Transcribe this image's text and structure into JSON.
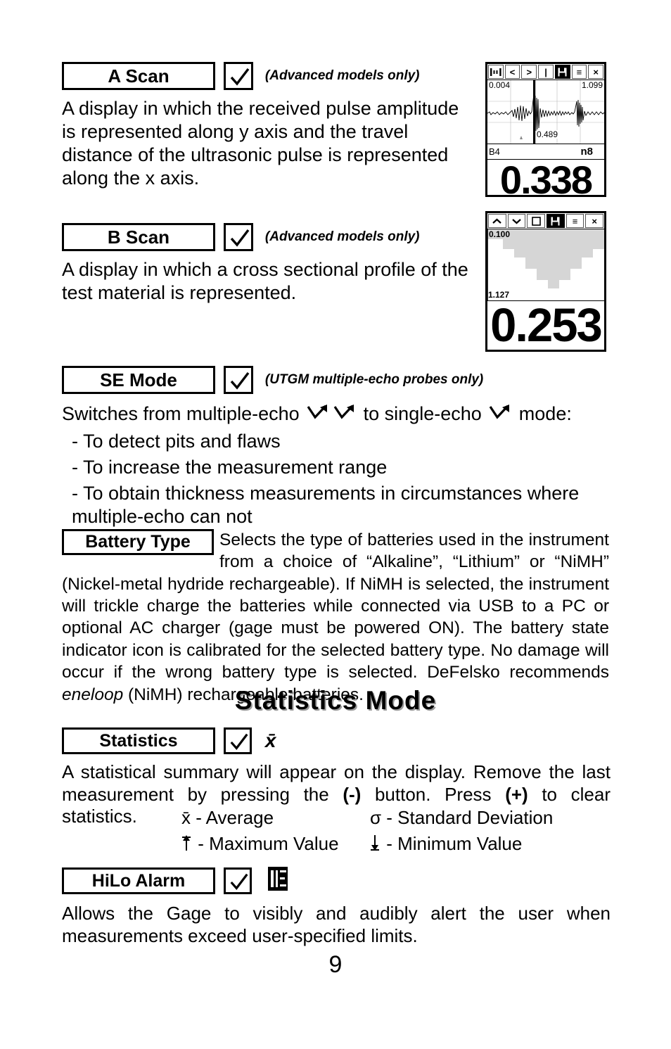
{
  "page": {
    "number": "9"
  },
  "sections": [
    {
      "id": "a-scan",
      "label": "A Scan",
      "note": "(Advanced models only)",
      "body": "A display in which the received pulse amplitude is represented along y axis and the travel distance of the ultrasonic pulse is represented along the x axis."
    },
    {
      "id": "b-scan",
      "label": "B Scan",
      "note": "(Advanced models only)",
      "body": "A display in which a cross sectional profile of the test material is represented."
    },
    {
      "id": "se-mode",
      "label": "SE Mode",
      "note": "(UTGM multiple-echo probes only)",
      "intro_before": "Switches from multiple-echo",
      "intro_middle": "to single-echo",
      "intro_after": "mode:",
      "bullets": [
        "- To detect pits and flaws",
        "- To increase the measurement range",
        "- To obtain thickness measurements in circumstances where multiple-echo can not"
      ]
    }
  ],
  "battery": {
    "label": "Battery Type",
    "body_part1": "Selects the type of batteries used in the instrument from a choice of “Alkaline”, “Lithium” or “NiMH” (Nickel-metal hydride rechargeable). If NiMH is selected, the instrument will trickle charge the batteries while connected via USB to a PC or optional AC charger (gage must be powered ON). The battery state indicator icon is calibrated for the selected battery type. No damage will occur if the wrong battery type is selected. DeFelsko recommends ",
    "body_italic": "eneloop",
    "body_part2": " (NiMH) rechargeable batteries."
  },
  "statistics_mode": {
    "heading": "Statistics Mode",
    "statistics": {
      "label": "Statistics",
      "icon_symbol": "x̄",
      "body_a": "A statistical summary will appear on the display. Remove the last measurement by pressing the ",
      "body_b": "(-)",
      "body_c": " button.   Press ",
      "body_d": "(+)",
      "body_e": " to clear statistics.",
      "symbols": [
        {
          "symbol": "x̄",
          "text": "- Average"
        },
        {
          "symbol": "σ",
          "text": "- Standard Deviation"
        },
        {
          "symbol": "↑",
          "text": "- Maximum Value"
        },
        {
          "symbol": "↓",
          "text": "- Minimum Value"
        }
      ]
    },
    "hilo": {
      "label": "HiLo Alarm",
      "body": "Allows the Gage to visibly and audibly alert the user when measurements exceed user-specified limits."
    }
  },
  "devices": {
    "a_scan": {
      "toolbar": [
        "gate-icon",
        "<",
        ">",
        "|",
        "save-icon",
        "≡",
        "×"
      ],
      "toolbar_selected_index": 4,
      "left_tick": "0.004",
      "right_tick": "1.099",
      "cursor_value": "0.489",
      "bottom_left_label": "B4",
      "bottom_right_label": "n8",
      "reading": "0.338"
    },
    "b_scan": {
      "toolbar": [
        "⌃",
        "⌄",
        "□",
        "save-icon",
        "≡",
        "×"
      ],
      "toolbar_selected_index": 3,
      "top_tick": "0.100",
      "bottom_tick": "1.127",
      "reading": "0.253"
    }
  },
  "colors": {
    "ink": "#000000",
    "paper": "#ffffff",
    "profile_gray": "#d6d6d6",
    "heading_shadow": "#9a9a9a"
  }
}
